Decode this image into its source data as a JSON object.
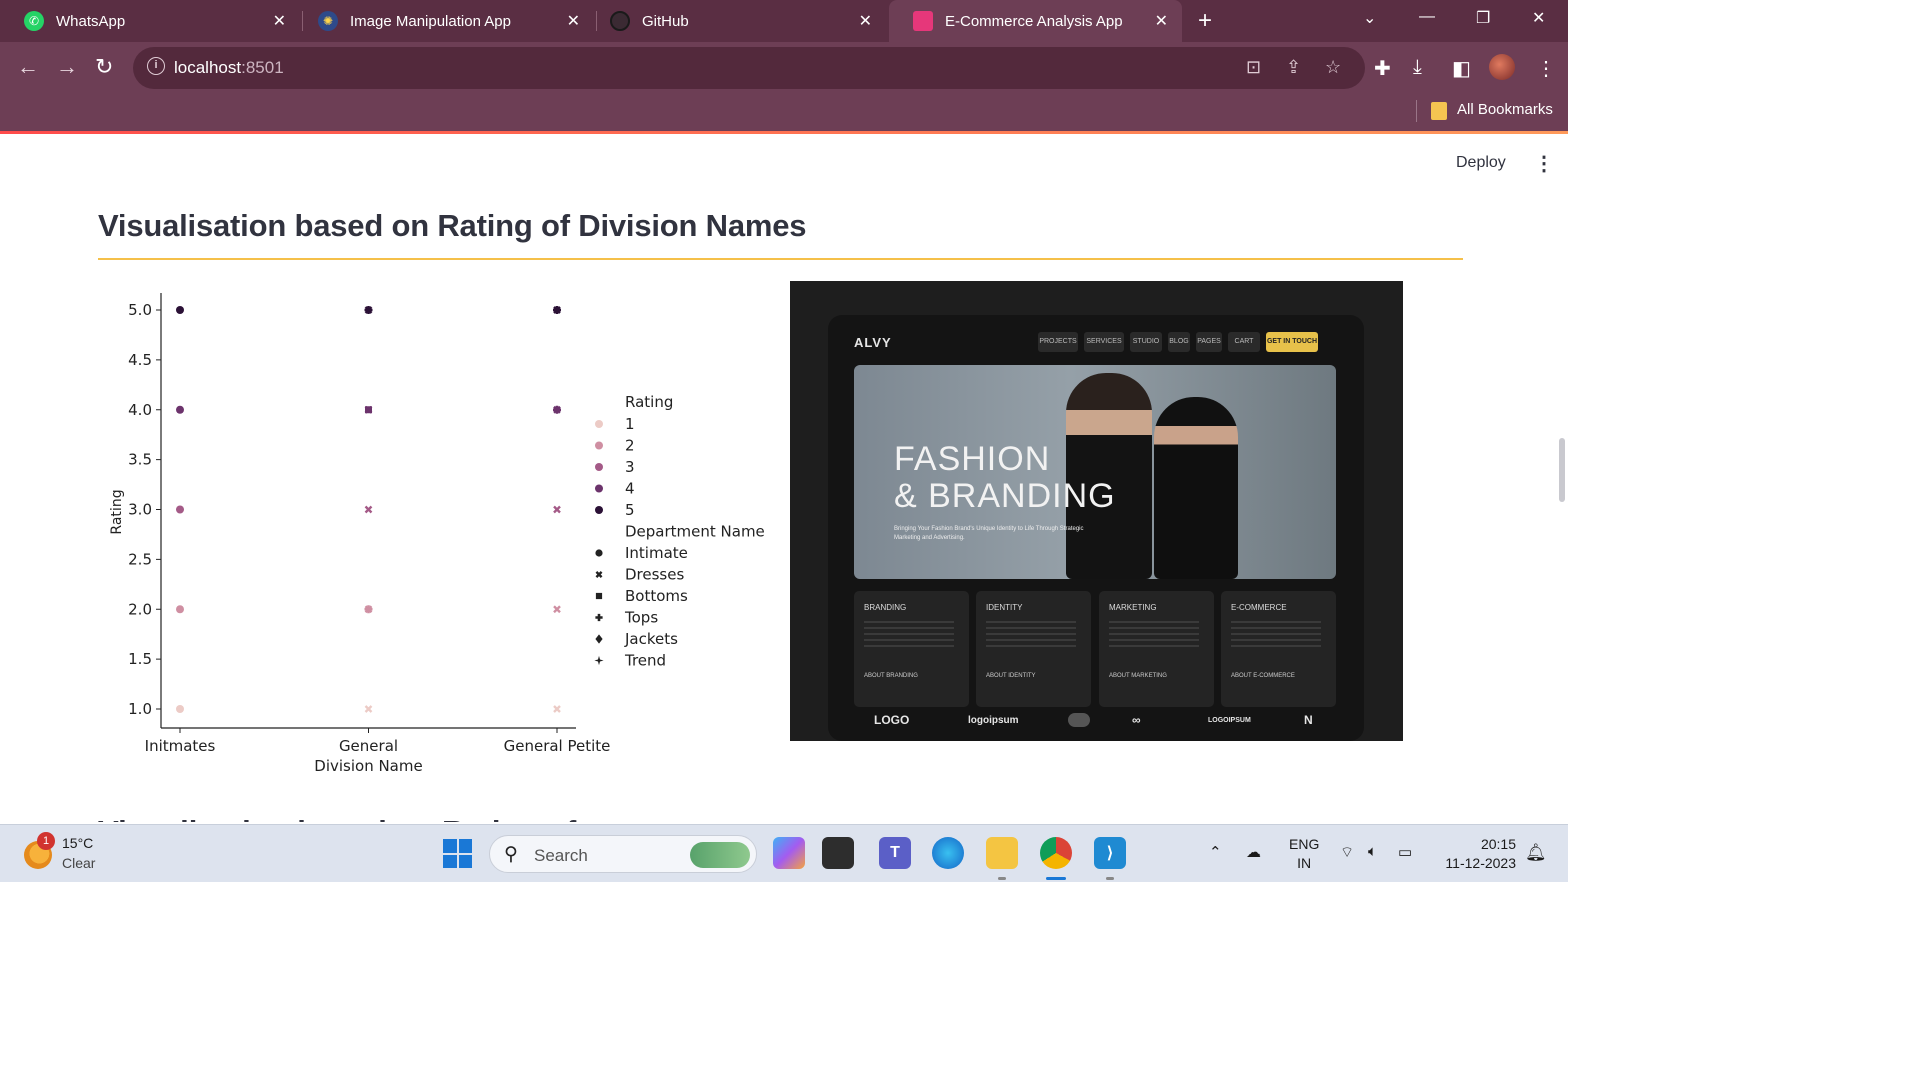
{
  "browser": {
    "tabs": [
      {
        "title": "WhatsApp",
        "icon": "whatsapp-icon",
        "active": false
      },
      {
        "title": "Image Manipulation App",
        "icon": "app-icon",
        "active": false
      },
      {
        "title": "GitHub",
        "icon": "github-icon",
        "active": false
      },
      {
        "title": "E-Commerce Analysis App",
        "icon": "app-icon",
        "active": true
      }
    ],
    "url_host": "localhost",
    "url_port": ":8501",
    "bookmarks_label": "All Bookmarks",
    "theme_color": "#6d3e55"
  },
  "app": {
    "deploy_label": "Deploy",
    "menu_icon": "kebab-menu-icon",
    "heading": "Visualisation based on Rating of Division Names",
    "accent_color": "#f5c04a"
  },
  "chart_data": {
    "type": "scatter",
    "xlabel": "Division Name",
    "ylabel": "Rating",
    "categories": [
      "Initmates",
      "General",
      "General Petite"
    ],
    "yticks": [
      "1.0",
      "1.5",
      "2.0",
      "2.5",
      "3.0",
      "3.5",
      "4.0",
      "4.5",
      "5.0"
    ],
    "ylim": [
      1.0,
      5.0
    ],
    "grid": false,
    "legend": {
      "hue_title": "Rating",
      "hue_levels": [
        {
          "label": "1",
          "color": "#eccbc6"
        },
        {
          "label": "2",
          "color": "#cf8fa2"
        },
        {
          "label": "3",
          "color": "#a45a87"
        },
        {
          "label": "4",
          "color": "#6c336c"
        },
        {
          "label": "5",
          "color": "#2b1136"
        }
      ],
      "style_title": "Department Name",
      "style_levels": [
        {
          "label": "Intimate",
          "marker": "circle"
        },
        {
          "label": "Dresses",
          "marker": "x"
        },
        {
          "label": "Bottoms",
          "marker": "square"
        },
        {
          "label": "Tops",
          "marker": "plus"
        },
        {
          "label": "Jackets",
          "marker": "diamond"
        },
        {
          "label": "Trend",
          "marker": "star"
        }
      ],
      "placement": "right"
    },
    "points": [
      {
        "x": "Initmates",
        "y": 5,
        "marker": "circle"
      },
      {
        "x": "Initmates",
        "y": 4,
        "marker": "circle"
      },
      {
        "x": "Initmates",
        "y": 3,
        "marker": "circle"
      },
      {
        "x": "Initmates",
        "y": 2,
        "marker": "circle"
      },
      {
        "x": "Initmates",
        "y": 1,
        "marker": "circle"
      },
      {
        "x": "General",
        "y": 5,
        "marker": "x"
      },
      {
        "x": "General",
        "y": 4,
        "marker": "x"
      },
      {
        "x": "General",
        "y": 3,
        "marker": "x"
      },
      {
        "x": "General",
        "y": 2,
        "marker": "x"
      },
      {
        "x": "General",
        "y": 1,
        "marker": "x"
      },
      {
        "x": "General",
        "y": 5,
        "marker": "plus"
      },
      {
        "x": "General",
        "y": 4,
        "marker": "square"
      },
      {
        "x": "General",
        "y": 2,
        "marker": "plus"
      },
      {
        "x": "General Petite",
        "y": 5,
        "marker": "x"
      },
      {
        "x": "General Petite",
        "y": 4,
        "marker": "x"
      },
      {
        "x": "General Petite",
        "y": 3,
        "marker": "x"
      },
      {
        "x": "General Petite",
        "y": 2,
        "marker": "x"
      },
      {
        "x": "General Petite",
        "y": 1,
        "marker": "x"
      },
      {
        "x": "General Petite",
        "y": 5,
        "marker": "plus"
      },
      {
        "x": "General Petite",
        "y": 4,
        "marker": "plus"
      }
    ]
  },
  "mockup_image": {
    "logo": "ALVY",
    "nav": [
      "PROJECTS",
      "SERVICES",
      "STUDIO",
      "BLOG",
      "PAGES",
      "CART",
      "GET IN TOUCH"
    ],
    "hero_title_line1": "FASHION",
    "hero_title_line2": "& BRANDING",
    "hero_subtitle": "Bringing Your Fashion Brand's Unique Identity to Life Through Strategic Marketing and Advertising.",
    "cards": [
      {
        "title": "BRANDING",
        "link": "ABOUT BRANDING"
      },
      {
        "title": "IDENTITY",
        "link": "ABOUT IDENTITY"
      },
      {
        "title": "MARKETING",
        "link": "ABOUT MARKETING"
      },
      {
        "title": "E-COMMERCE",
        "link": "ABOUT E-COMMERCE"
      }
    ],
    "partner_logos": [
      "LOGO",
      "logoipsum",
      "LOGOIPSUM"
    ]
  },
  "taskbar": {
    "weather_badge": "1",
    "temperature": "15°C",
    "condition": "Clear",
    "search_label": "Search",
    "lang_line1": "ENG",
    "lang_line2": "IN",
    "time": "20:15",
    "date": "11-12-2023"
  }
}
